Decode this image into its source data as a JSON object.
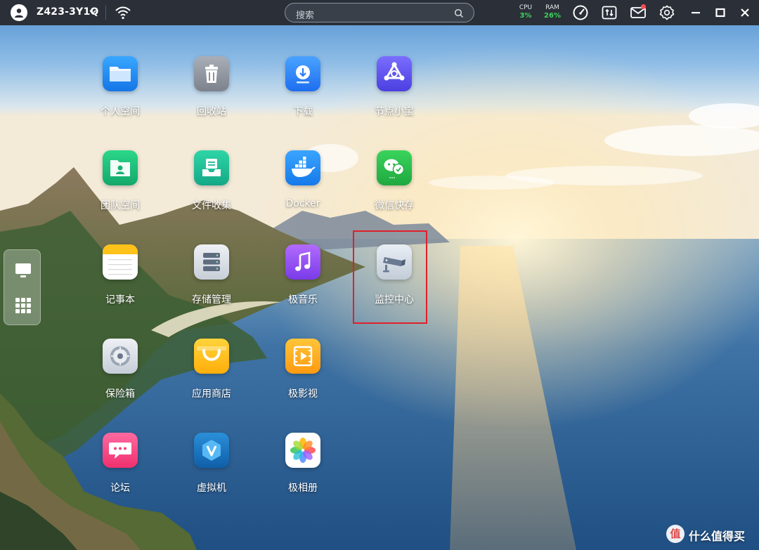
{
  "topbar": {
    "device_name": "Z423-3Y1Q",
    "search_placeholder": "搜索",
    "cpu_label": "CPU",
    "cpu_value": "3%",
    "ram_label": "RAM",
    "ram_value": "26%",
    "icons": [
      "user-avatar-icon",
      "wifi-icon",
      "search-icon",
      "gauge-icon",
      "updown-icon",
      "mail-icon",
      "gear-icon",
      "minimize-icon",
      "maximize-icon",
      "close-icon"
    ],
    "status_color": "#3ed45b"
  },
  "dock": {
    "icons": [
      "monitor-icon",
      "app-grid-icon"
    ]
  },
  "apps": [
    {
      "label": "个人空间",
      "icon": "folder-icon"
    },
    {
      "label": "回收站",
      "icon": "trash-icon"
    },
    {
      "label": "下载",
      "icon": "download-icon"
    },
    {
      "label": "节点小宝",
      "icon": "node-icon"
    },
    {
      "label": "团队空间",
      "icon": "team-folder-icon"
    },
    {
      "label": "文件收集",
      "icon": "inbox-icon"
    },
    {
      "label": "Docker",
      "icon": "docker-icon"
    },
    {
      "label": "微信快存",
      "icon": "wechat-icon"
    },
    {
      "label": "记事本",
      "icon": "notepad-icon"
    },
    {
      "label": "存储管理",
      "icon": "storage-icon"
    },
    {
      "label": "极音乐",
      "icon": "music-icon"
    },
    {
      "label": "监控中心",
      "icon": "camera-icon"
    },
    {
      "label": "保险箱",
      "icon": "safe-icon"
    },
    {
      "label": "应用商店",
      "icon": "store-icon"
    },
    {
      "label": "极影视",
      "icon": "video-icon"
    },
    {
      "label": "论坛",
      "icon": "forum-icon"
    },
    {
      "label": "虚拟机",
      "icon": "vm-icon"
    },
    {
      "label": "极相册",
      "icon": "photos-icon"
    }
  ],
  "highlight": {
    "target": "监控中心",
    "color": "#e0202a"
  },
  "watermark": {
    "glyph": "值",
    "text": "什么值得买"
  }
}
